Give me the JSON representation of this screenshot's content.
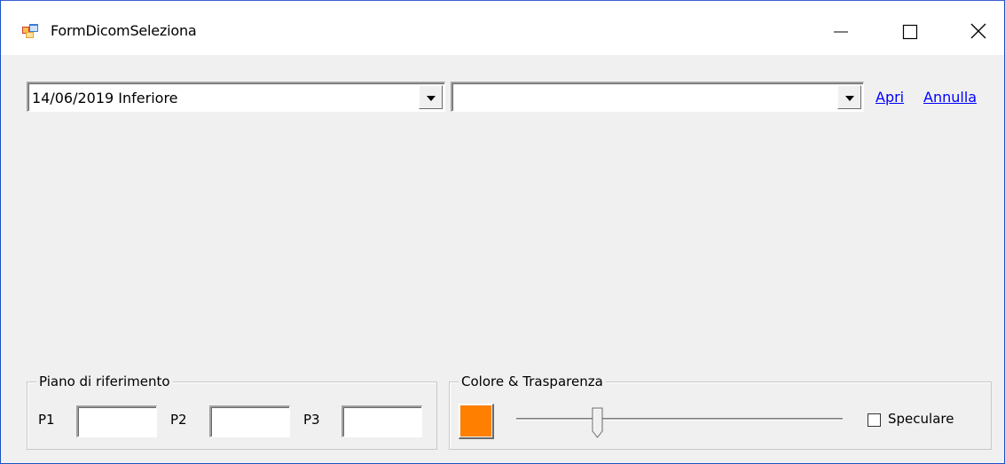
{
  "window": {
    "title": "FormDicomSeleziona",
    "controls": {
      "minimize": "—",
      "maximize": "☐",
      "close": "✕"
    }
  },
  "top": {
    "combo1_value": "14/06/2019 Inferiore",
    "combo2_value": "",
    "apri_label": "Apri",
    "annulla_label": "Annulla"
  },
  "piano": {
    "title": "Piano di riferimento",
    "p1_label": "P1",
    "p2_label": "P2",
    "p3_label": "P3",
    "p1_value": "",
    "p2_value": "",
    "p3_value": ""
  },
  "colore": {
    "title": "Colore & Trasparenza",
    "swatch_color": "#ff7f00",
    "slider_value": 0.24,
    "speculare_label": "Speculare",
    "speculare_checked": false
  }
}
